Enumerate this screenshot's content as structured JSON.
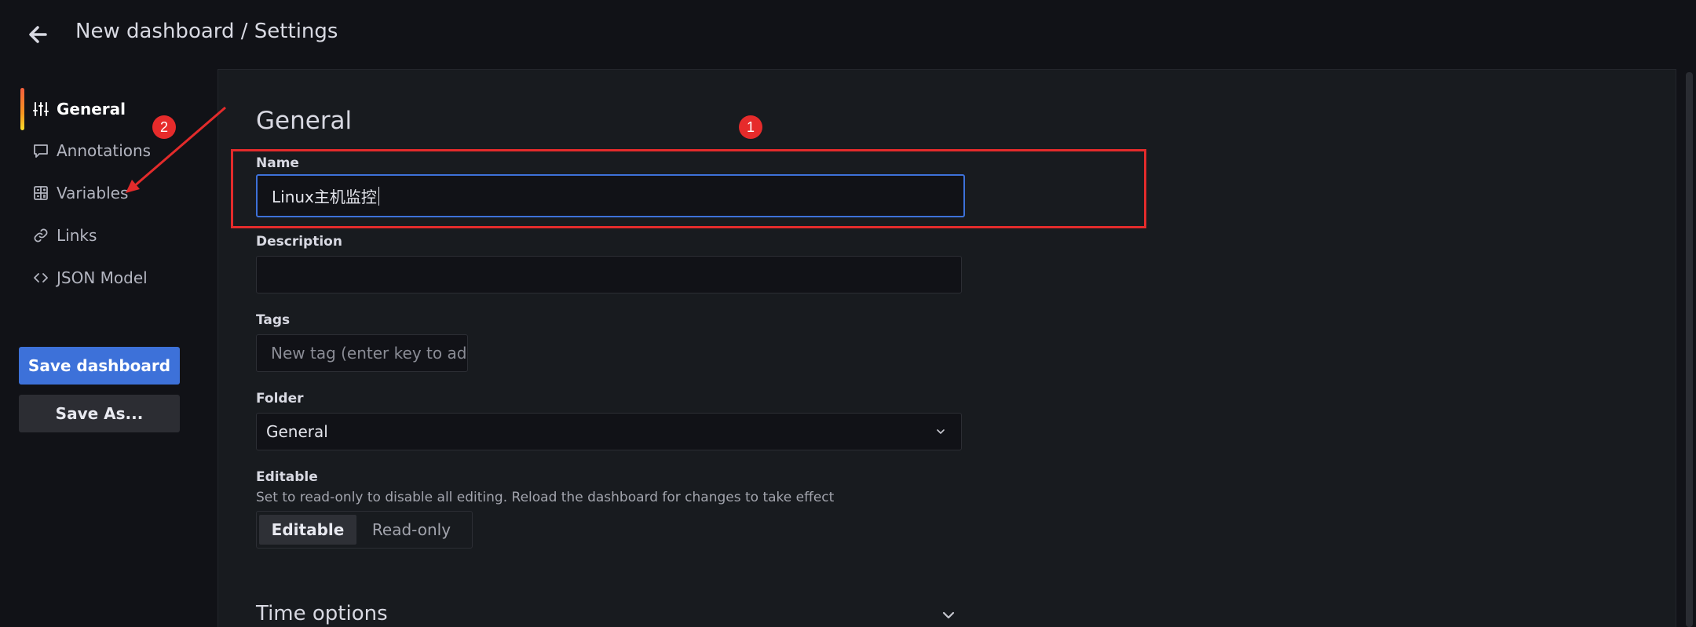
{
  "header": {
    "title": "New dashboard / Settings"
  },
  "nav": {
    "items": [
      {
        "label": "General",
        "icon": "sliders-icon",
        "active": true
      },
      {
        "label": "Annotations",
        "icon": "comment-icon",
        "active": false
      },
      {
        "label": "Variables",
        "icon": "calculator-icon",
        "active": false
      },
      {
        "label": "Links",
        "icon": "link-icon",
        "active": false
      },
      {
        "label": "JSON Model",
        "icon": "code-icon",
        "active": false
      }
    ],
    "save_label": "Save dashboard",
    "save_as_label": "Save As..."
  },
  "general": {
    "title": "General",
    "name_label": "Name",
    "name_value": "Linux主机监控",
    "description_label": "Description",
    "description_value": "",
    "tags_label": "Tags",
    "tags_placeholder": "New tag (enter key to add",
    "folder_label": "Folder",
    "folder_value": "General",
    "editable_label": "Editable",
    "editable_description": "Set to read-only to disable all editing. Reload the dashboard for changes to take effect",
    "editable_options": [
      "Editable",
      "Read-only"
    ],
    "editable_selected": "Editable",
    "time_options_label": "Time options"
  },
  "annotations": {
    "badge_1": "1",
    "badge_2": "2",
    "color": "#e32b2b"
  },
  "colors": {
    "accent": "#3d71d9",
    "background": "#111217",
    "panel": "#181b1f"
  }
}
